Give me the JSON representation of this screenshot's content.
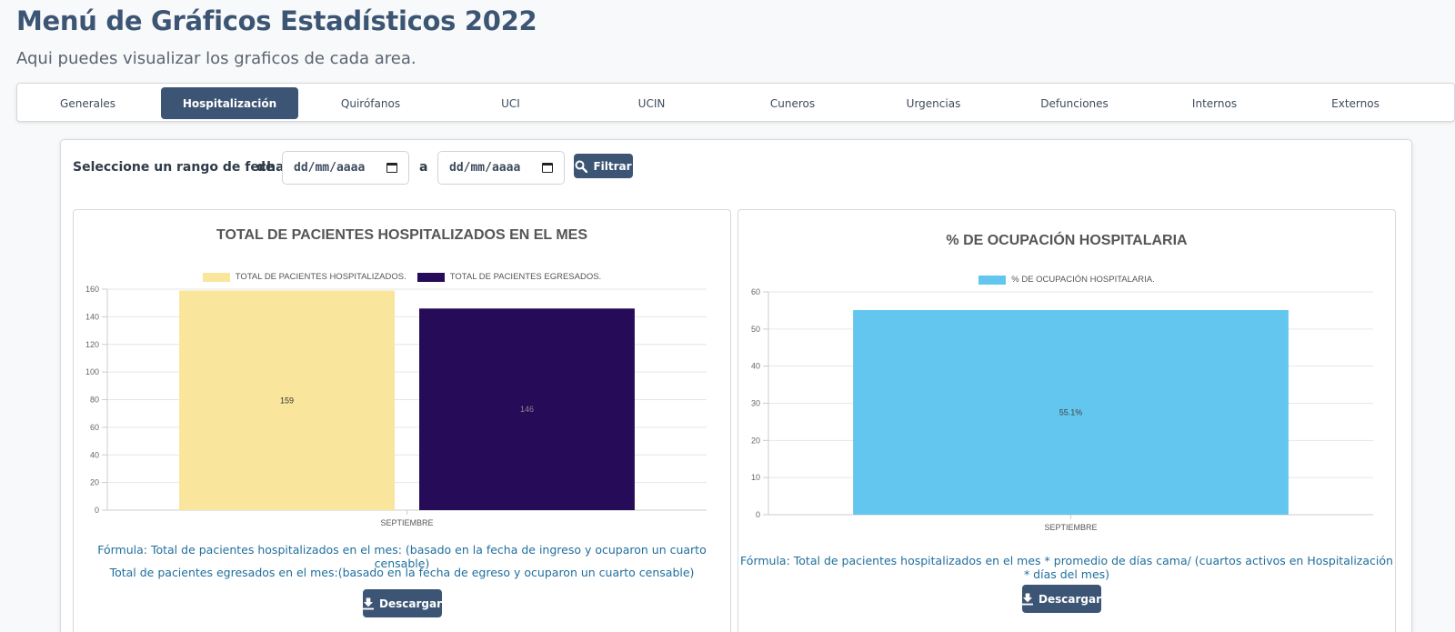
{
  "page": {
    "title": "Menú de Gráficos Estadísticos 2022",
    "subtitle": "Aqui puedes visualizar los graficos de cada area."
  },
  "tabs": [
    {
      "label": "Generales",
      "active": false
    },
    {
      "label": "Hospitalización",
      "active": true
    },
    {
      "label": "Quirófanos",
      "active": false
    },
    {
      "label": "UCI",
      "active": false
    },
    {
      "label": "UCIN",
      "active": false
    },
    {
      "label": "Cuneros",
      "active": false
    },
    {
      "label": "Urgencias",
      "active": false
    },
    {
      "label": "Defunciones",
      "active": false
    },
    {
      "label": "Internos",
      "active": false
    },
    {
      "label": "Externos",
      "active": false
    }
  ],
  "filter": {
    "label": "Seleccione un rango de fechas:",
    "from_label": "de",
    "to_label": "a",
    "from_placeholder": "dd/mm/aaaa",
    "to_placeholder": "dd/mm/aaaa",
    "button_label": "Filtrar",
    "button_icon": "search-icon"
  },
  "colors": {
    "accent": "#3d5574",
    "hospitalizados": "#f9e59c",
    "egresados": "#260b58",
    "ocupacion": "#62c6ef",
    "formula_text": "#1f6e9c"
  },
  "left_panel": {
    "formula_1": "Fórmula: Total de pacientes hospitalizados en el mes: (basado en la fecha de ingreso y ocuparon un cuarto censable)",
    "formula_2": "Total de pacientes egresados en el mes:(basado en la fecha de egreso y ocuparon un cuarto censable)",
    "download_label": "Descargar",
    "download_icon": "download-icon"
  },
  "right_panel": {
    "formula_1": "Fórmula: Total de pacientes hospitalizados en el mes * promedio de días cama/ (cuartos activos en Hospitalización * días del mes)",
    "download_label": "Descargar",
    "download_icon": "download-icon"
  },
  "chart_data": [
    {
      "type": "bar",
      "title": "TOTAL DE PACIENTES HOSPITALIZADOS EN EL MES",
      "categories": [
        "SEPTIEMBRE"
      ],
      "series": [
        {
          "name": "TOTAL DE PACIENTES HOSPITALIZADOS.",
          "values": [
            159
          ],
          "data_label": "159"
        },
        {
          "name": "TOTAL DE PACIENTES EGRESADOS.",
          "values": [
            146
          ],
          "data_label": "146"
        }
      ],
      "ylim": [
        0,
        160
      ],
      "yticks": [
        "0",
        "20",
        "40",
        "60",
        "80",
        "100",
        "120",
        "140",
        "160"
      ],
      "grid": true,
      "legend": "top"
    },
    {
      "type": "bar",
      "title": "% DE OCUPACIÓN HOSPITALARIA",
      "categories": [
        "SEPTIEMBRE"
      ],
      "series": [
        {
          "name": "% DE OCUPACIÓN HOSPITALARIA.",
          "values": [
            55.1
          ],
          "data_label": "55.1%"
        }
      ],
      "ylim": [
        0,
        60
      ],
      "yticks": [
        "0",
        "10",
        "20",
        "30",
        "40",
        "50",
        "60"
      ],
      "grid": true,
      "legend": "top"
    }
  ]
}
